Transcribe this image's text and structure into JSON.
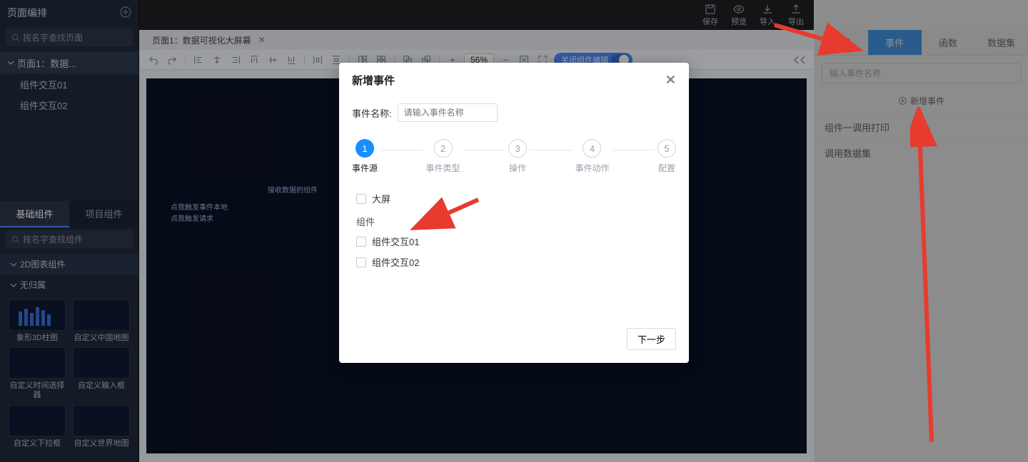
{
  "left": {
    "title": "页面编排",
    "search_ph": "按名字查找页面",
    "page_root": "页面1：数据...",
    "page_children": [
      "组件交互01",
      "组件交互02"
    ],
    "comp_tabs": [
      "基础组件",
      "项目组件"
    ],
    "comp_search_ph": "按名字查找组件",
    "group_2d": "2D图表组件",
    "group_none": "无归属",
    "items": [
      "象形3D柱图",
      "自定义中国地图",
      "自定义时间选择器",
      "自定义输入框",
      "自定义下拉框",
      "自定义世界地图"
    ]
  },
  "crumb": "页面1：数据可视化大屏幕",
  "topbar": [
    "保存",
    "预览",
    "导入",
    "导出"
  ],
  "canvas": {
    "label_top": "接收数据的组件",
    "label_a": "点我触发事件本地",
    "label_b": "点我触发请求"
  },
  "zoom": "56%",
  "toggle_label": "关闭组件编辑",
  "right": {
    "tabs": [
      "设置",
      "事件",
      "函数",
      "数据集"
    ],
    "search_ph": "输入事件名称",
    "add": "新增事件",
    "items": [
      "组件一调用打印",
      "调用数据集"
    ]
  },
  "modal": {
    "title": "新增事件",
    "name_label": "事件名称:",
    "name_ph": "请输入事件名称",
    "steps": [
      "事件源",
      "事件类型",
      "操作",
      "事件动作",
      "配置"
    ],
    "chk_bigscreen": "大屏",
    "group_comp": "组件",
    "chks": [
      "组件交互01",
      "组件交互02"
    ],
    "next": "下一步"
  }
}
